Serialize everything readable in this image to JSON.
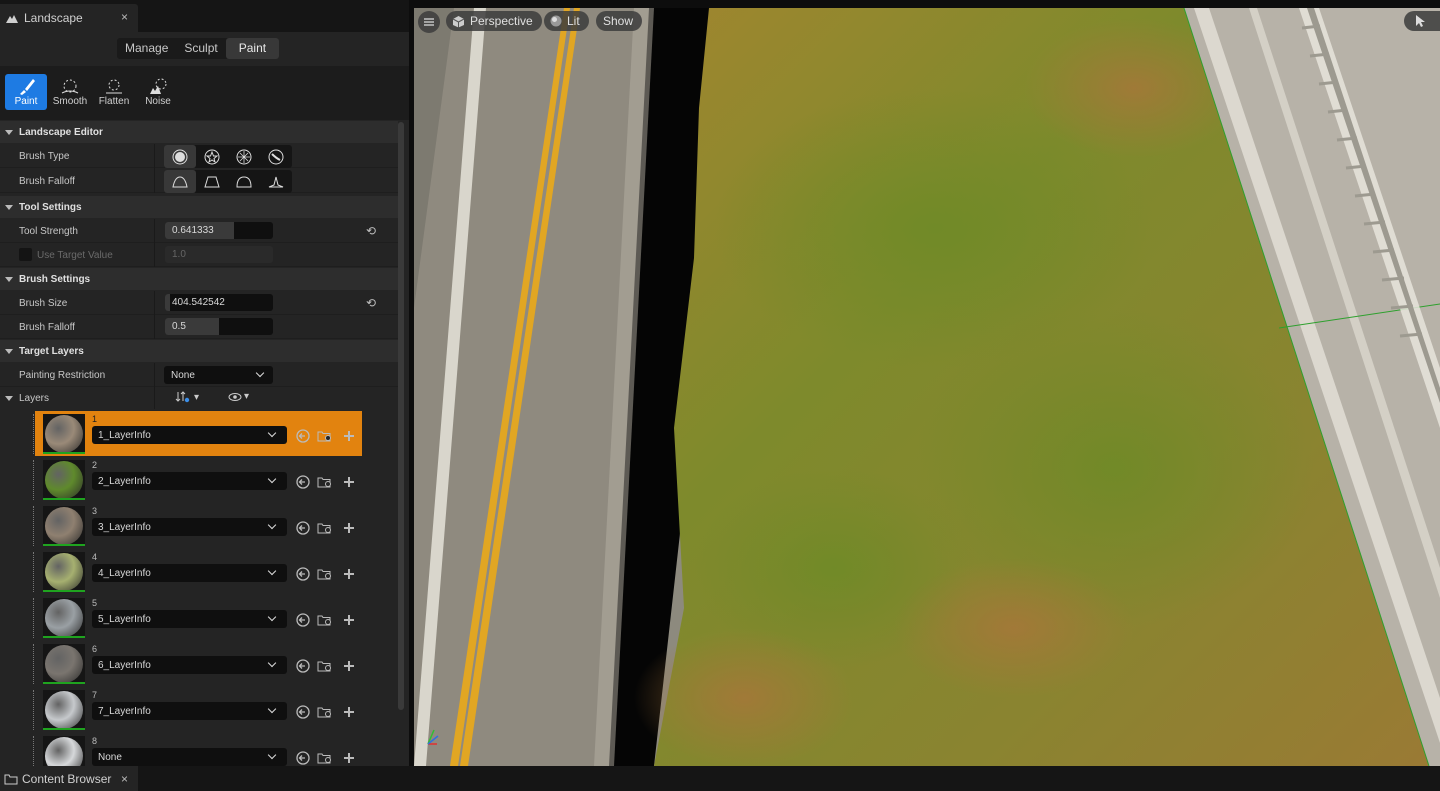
{
  "panel_tab": {
    "title": "Landscape",
    "close": "×"
  },
  "modes": [
    "Manage",
    "Sculpt",
    "Paint"
  ],
  "tools": [
    {
      "label": "Paint",
      "icon": "paintbrush-icon"
    },
    {
      "label": "Smooth",
      "icon": "smooth-icon"
    },
    {
      "label": "Flatten",
      "icon": "flatten-icon"
    },
    {
      "label": "Noise",
      "icon": "noise-icon"
    }
  ],
  "sections": {
    "landscape_editor": "Landscape Editor",
    "tool_settings": "Tool Settings",
    "brush_settings": "Brush Settings",
    "target_layers": "Target Layers"
  },
  "rows": {
    "brush_type": "Brush Type",
    "brush_falloff_type": "Brush Falloff",
    "tool_strength": "Tool Strength",
    "tool_strength_value": "0.641333",
    "tool_strength_fraction": 0.64,
    "use_target_value": "Use Target Value",
    "use_target_value_value": "1.0",
    "brush_size": "Brush Size",
    "brush_size_value": "404.542542",
    "brush_size_fraction": 0.05,
    "brush_falloff": "Brush Falloff",
    "brush_falloff_value": "0.5",
    "brush_falloff_fraction": 0.5,
    "painting_restriction": "Painting Restriction",
    "painting_restriction_value": "None",
    "layers": "Layers"
  },
  "layers": [
    {
      "index": "1",
      "name": "1_LayerInfo",
      "active": true,
      "color": "#9a8a78"
    },
    {
      "index": "2",
      "name": "2_LayerInfo",
      "active": false,
      "color": "#5f8a2c"
    },
    {
      "index": "3",
      "name": "3_LayerInfo",
      "active": false,
      "color": "#8f8070"
    },
    {
      "index": "4",
      "name": "4_LayerInfo",
      "active": false,
      "color": "#a6b070"
    },
    {
      "index": "5",
      "name": "5_LayerInfo",
      "active": false,
      "color": "#9aa0a4"
    },
    {
      "index": "6",
      "name": "6_LayerInfo",
      "active": false,
      "color": "#7a756f"
    },
    {
      "index": "7",
      "name": "7_LayerInfo",
      "active": false,
      "color": "#c6c9cc"
    },
    {
      "index": "8",
      "name": "None",
      "active": false,
      "color": "#d6d8da"
    }
  ],
  "viewport": {
    "perspective": "Perspective",
    "lit": "Lit",
    "show": "Show"
  },
  "bottom_tab": {
    "title": "Content Browser",
    "close": "×"
  },
  "colors": {
    "accent_blue": "#1e7be3",
    "active_layer": "#e2830f",
    "weight_green": "#1fa31f"
  }
}
